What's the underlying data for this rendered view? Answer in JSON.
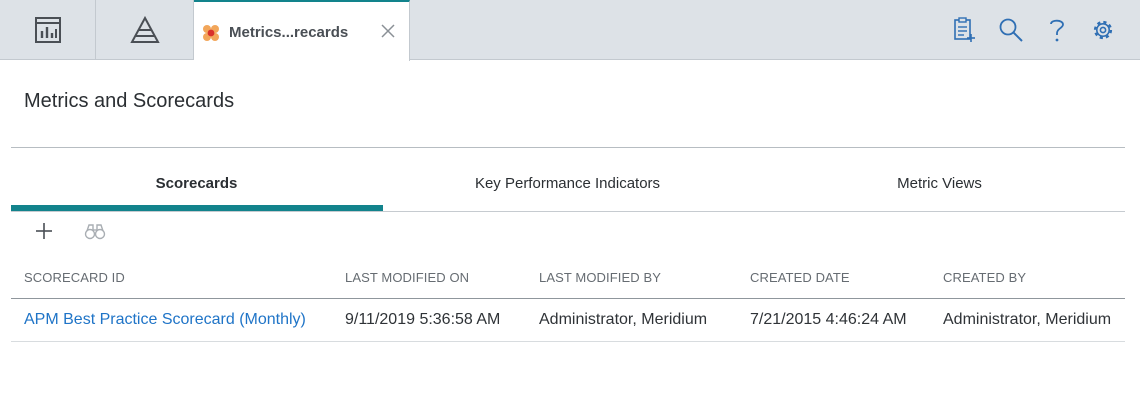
{
  "topbar": {
    "tiles": [
      {
        "icon": "dashboard-icon"
      },
      {
        "icon": "pyramid-icon"
      }
    ],
    "active_tab": {
      "icon": "metrics-app-icon",
      "title": "Metrics...recards",
      "close_icon": "close-icon"
    },
    "right_icons": [
      "add-document-icon",
      "search-icon",
      "help-icon",
      "settings-gear-icon"
    ],
    "colors": {
      "bar_bg": "#dde2e7",
      "accent": "#12838c"
    }
  },
  "page": {
    "title": "Metrics and Scorecards",
    "tabs": [
      {
        "label": "Scorecards",
        "active": true
      },
      {
        "label": "Key Performance Indicators",
        "active": false
      },
      {
        "label": "Metric Views",
        "active": false
      }
    ],
    "actions": [
      {
        "icon": "plus-icon"
      },
      {
        "icon": "binoculars-icon"
      }
    ]
  },
  "table": {
    "columns": [
      "SCORECARD ID",
      "LAST MODIFIED ON",
      "LAST MODIFIED BY",
      "CREATED DATE",
      "CREATED BY"
    ],
    "rows": [
      [
        "APM Best Practice Scorecard (Monthly)",
        "9/11/2019 5:36:58 AM",
        "Administrator, Meridium",
        "7/21/2015 4:46:24 AM",
        "Administrator, Meridium"
      ]
    ],
    "link_color": "#1f74c7"
  }
}
